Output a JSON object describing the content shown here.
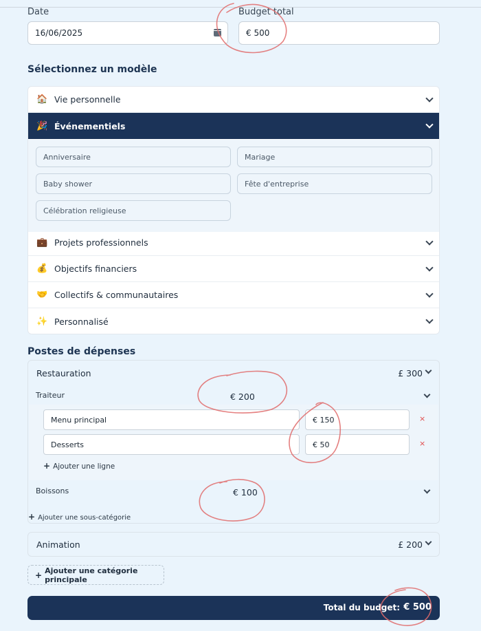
{
  "header": {
    "date_label": "Date",
    "date_value": "16/06/2025",
    "budget_label": "Budget total",
    "budget_value": "€ 500"
  },
  "models": {
    "title": "Sélectionnez un modèle",
    "items": [
      {
        "icon": "house-icon",
        "emoji": "🏠",
        "label": "Vie personnelle"
      },
      {
        "icon": "party-popper-icon",
        "emoji": "🎉",
        "label": "Événementiels"
      },
      {
        "icon": "briefcase-icon",
        "emoji": "💼",
        "label": "Projets professionnels"
      },
      {
        "icon": "money-bag-icon",
        "emoji": "💰",
        "label": "Objectifs financiers"
      },
      {
        "icon": "heart-hands-icon",
        "emoji": "🤝",
        "label": "Collectifs & communautaires"
      },
      {
        "icon": "sparkles-icon",
        "emoji": "✨",
        "label": "Personnalisé"
      }
    ],
    "event_templates": [
      "Anniversaire",
      "Mariage",
      "Baby shower",
      "Fête d'entreprise",
      "Célébration religieuse"
    ]
  },
  "expenses": {
    "title": "Postes de dépenses",
    "category": {
      "label": "Restauration",
      "amount": "£ 300"
    },
    "sub1": {
      "label": "Traiteur",
      "amount": "€ 200"
    },
    "lines": [
      {
        "label": "Menu principal",
        "value": "€ 150",
        "remove": "×"
      },
      {
        "label": "Desserts",
        "value": "€ 50",
        "remove": "×"
      }
    ],
    "add_line": "Ajouter une ligne",
    "sub2": {
      "label": "Boissons",
      "amount": "€ 100"
    },
    "add_subcategory": "Ajouter une sous-catégorie",
    "animation": {
      "label": "Animation",
      "amount": "£ 200"
    },
    "add_main": "Ajouter une catégorie principale"
  },
  "total": {
    "label": "Total du budget:",
    "value": "€ 500"
  },
  "colors": {
    "navy": "#1b3358",
    "background": "#eaf4fc",
    "annotation": "#e06b6b"
  }
}
